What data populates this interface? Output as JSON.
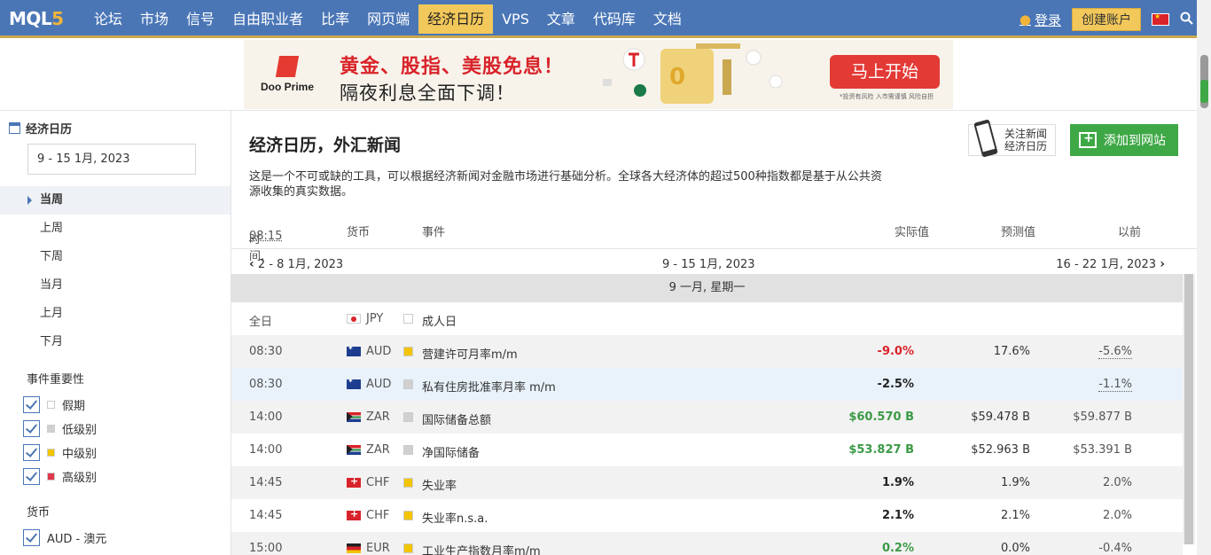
{
  "nav": {
    "logo_main": "MQL",
    "logo_five": "5",
    "items": [
      {
        "label": "论坛"
      },
      {
        "label": "市场"
      },
      {
        "label": "信号"
      },
      {
        "label": "自由职业者"
      },
      {
        "label": "比率"
      },
      {
        "label": "网页端"
      },
      {
        "label": "经济日历",
        "active": true
      },
      {
        "label": "VPS"
      },
      {
        "label": "文章"
      },
      {
        "label": "代码库"
      },
      {
        "label": "文档"
      }
    ],
    "login": "登录",
    "create_account": "创建账户"
  },
  "banner": {
    "brand": "Doo Prime",
    "headline": "黄金、股指、美股免息！",
    "subline": "隔夜利息全面下调！",
    "cta": "马上开始",
    "note": "*投资有风险 入市需谨慎 风险自担"
  },
  "sidebar": {
    "title": "经济日历",
    "date_range": "9 - 15 1月, 2023",
    "periods": [
      "当周",
      "上周",
      "下周",
      "当月",
      "上月",
      "下月"
    ],
    "importance_title": "事件重要性",
    "importance": [
      {
        "label": "假期",
        "color": "#ffffff"
      },
      {
        "label": "低级别",
        "color": "#d0d0d0"
      },
      {
        "label": "中级别",
        "color": "#f2c400"
      },
      {
        "label": "高级别",
        "color": "#e0384a"
      }
    ],
    "currency_title": "货币",
    "currencies": [
      "AUD - 澳元"
    ]
  },
  "main": {
    "title": "经济日历，外汇新闻",
    "description": "这是一个不可或缺的工具，可以根据经济新闻对金融市场进行基础分析。全球各大经济体的超过500种指数都是基于从公共资源收集的真实数据。",
    "follow_label_1": "关注新闻",
    "follow_label_2": "经济日历",
    "add_to_site": "添加到网站",
    "columns": {
      "time": "时间,",
      "time_value": "08:15",
      "currency": "货币",
      "event": "事件",
      "actual": "实际值",
      "forecast": "预测值",
      "previous": "以前"
    },
    "week_prev": "2 - 8 1月, 2023",
    "week_current": "9 - 15 1月, 2023",
    "week_next": "16 - 22 1月, 2023",
    "day_header": "9 一月, 星期一"
  },
  "events": [
    {
      "time": "全日",
      "flag": "jp",
      "currency": "JPY",
      "importance": "#ffffff",
      "event": "成人日",
      "actual": "",
      "forecast": "",
      "previous": "",
      "prev_dot": false,
      "actual_class": ""
    },
    {
      "time": "08:30",
      "flag": "au",
      "currency": "AUD",
      "importance": "#f2c400",
      "event": "营建许可月率m/m",
      "actual": "-9.0%",
      "forecast": "17.6%",
      "previous": "-5.6%",
      "prev_dot": true,
      "actual_class": "neg"
    },
    {
      "time": "08:30",
      "flag": "au",
      "currency": "AUD",
      "importance": "#d0d0d0",
      "event": "私有住房批准率月率 m/m",
      "actual": "-2.5%",
      "forecast": "",
      "previous": "-1.1%",
      "prev_dot": true,
      "actual_class": ""
    },
    {
      "time": "14:00",
      "flag": "za",
      "currency": "ZAR",
      "importance": "#d0d0d0",
      "event": "国际储备总额",
      "actual": "$60.570 B",
      "forecast": "$59.478 B",
      "previous": "$59.877 B",
      "prev_dot": false,
      "actual_class": "pos"
    },
    {
      "time": "14:00",
      "flag": "za",
      "currency": "ZAR",
      "importance": "#d0d0d0",
      "event": "净国际储备",
      "actual": "$53.827 B",
      "forecast": "$52.963 B",
      "previous": "$53.391 B",
      "prev_dot": false,
      "actual_class": "pos"
    },
    {
      "time": "14:45",
      "flag": "ch",
      "currency": "CHF",
      "importance": "#f2c400",
      "event": "失业率",
      "actual": "1.9%",
      "forecast": "1.9%",
      "previous": "2.0%",
      "prev_dot": false,
      "actual_class": ""
    },
    {
      "time": "14:45",
      "flag": "ch",
      "currency": "CHF",
      "importance": "#f2c400",
      "event": "失业率n.s.a.",
      "actual": "2.1%",
      "forecast": "2.1%",
      "previous": "2.0%",
      "prev_dot": false,
      "actual_class": ""
    },
    {
      "time": "15:00",
      "flag": "eu",
      "currency": "EUR",
      "importance": "#f2c400",
      "event": "工业生产指数月率m/m",
      "actual": "0.2%",
      "forecast": "0.0%",
      "previous": "-0.4%",
      "prev_dot": true,
      "actual_class": "pos"
    }
  ]
}
